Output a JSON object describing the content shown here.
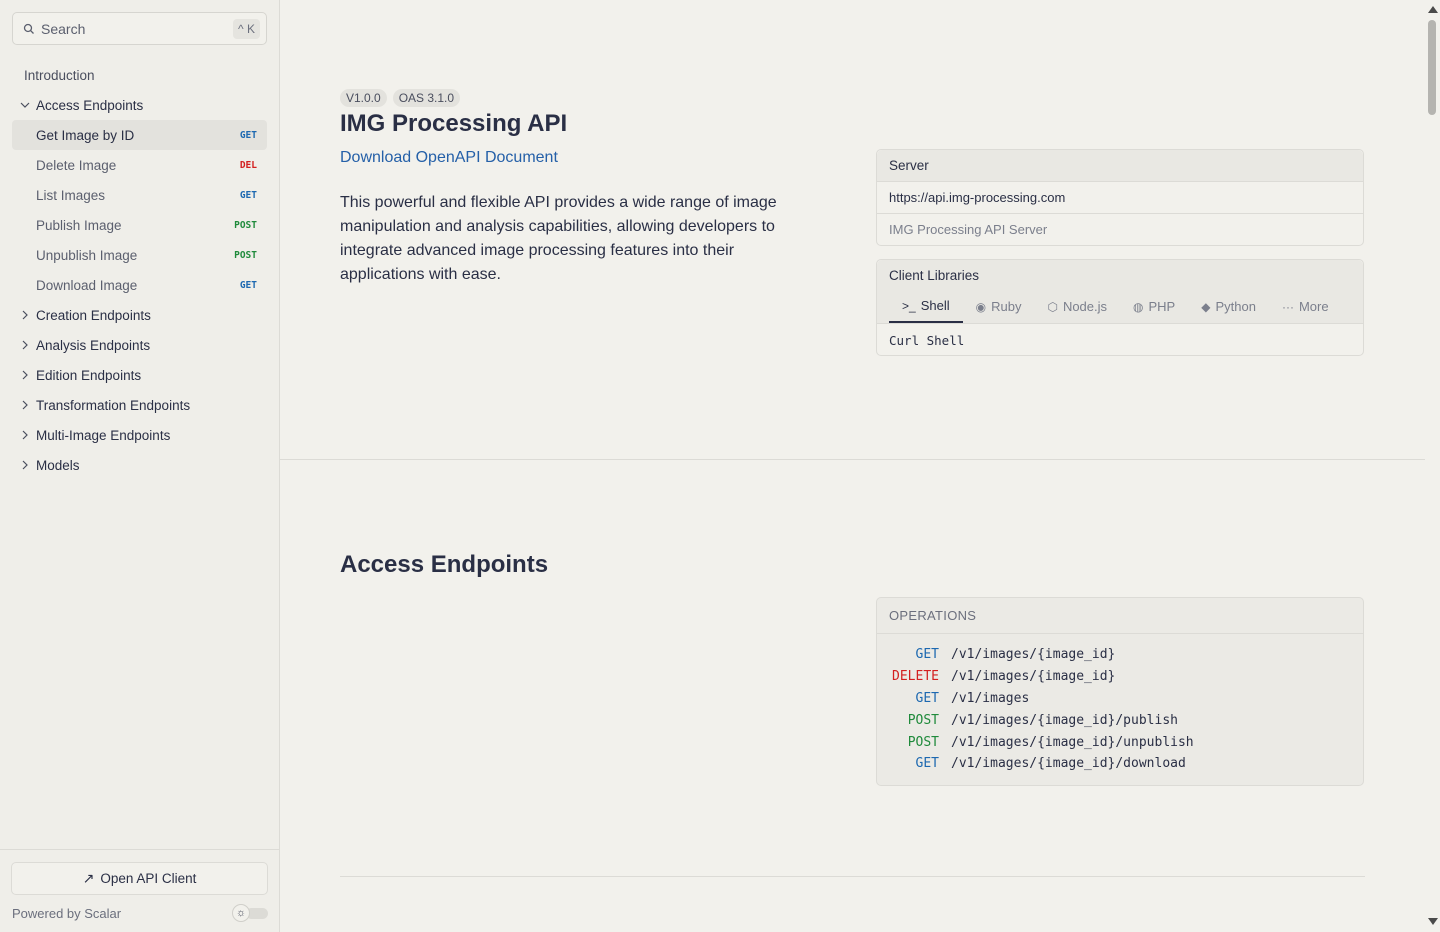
{
  "sidebar": {
    "search": {
      "placeholder": "Search",
      "shortcut": "^ K"
    },
    "introduction": "Introduction",
    "access_group": "Access Endpoints",
    "access_items": [
      {
        "label": "Get Image by ID",
        "method": "GET"
      },
      {
        "label": "Delete Image",
        "method": "DEL"
      },
      {
        "label": "List Images",
        "method": "GET"
      },
      {
        "label": "Publish Image",
        "method": "POST"
      },
      {
        "label": "Unpublish Image",
        "method": "POST"
      },
      {
        "label": "Download Image",
        "method": "GET"
      }
    ],
    "groups": [
      "Creation Endpoints",
      "Analysis Endpoints",
      "Edition Endpoints",
      "Transformation Endpoints",
      "Multi-Image Endpoints",
      "Models"
    ],
    "open_client": "Open API Client",
    "powered_by": "Powered by Scalar"
  },
  "header": {
    "version": "V1.0.0",
    "oas": "OAS 3.1.0",
    "title": "IMG Processing API",
    "download_link": "Download OpenAPI Document",
    "description": "This powerful and flexible API provides a wide range of image manipulation and analysis capabilities, allowing developers to integrate advanced image processing features into their applications with ease."
  },
  "server": {
    "label": "Server",
    "url": "https://api.img-processing.com",
    "description": "IMG Processing API Server"
  },
  "client_libraries": {
    "label": "Client Libraries",
    "tabs": [
      {
        "icon": ">_",
        "label": "Shell"
      },
      {
        "icon": "◉",
        "label": "Ruby"
      },
      {
        "icon": "⬡",
        "label": "Node.js"
      },
      {
        "icon": "◍",
        "label": "PHP"
      },
      {
        "icon": "◆",
        "label": "Python"
      },
      {
        "icon": "···",
        "label": "More"
      }
    ],
    "selected": "Curl Shell"
  },
  "section": {
    "title": "Access Endpoints",
    "operations_label": "OPERATIONS",
    "operations": [
      {
        "method": "GET",
        "path": "/v1/images/{image_id}"
      },
      {
        "method": "DELETE",
        "path": "/v1/images/{image_id}"
      },
      {
        "method": "GET",
        "path": "/v1/images"
      },
      {
        "method": "POST",
        "path": "/v1/images/{image_id}/publish"
      },
      {
        "method": "POST",
        "path": "/v1/images/{image_id}/unpublish"
      },
      {
        "method": "GET",
        "path": "/v1/images/{image_id}/download"
      }
    ]
  },
  "colors": {
    "get": "#1c68b0",
    "delete": "#d31f1f",
    "post": "#1f8a3b",
    "link": "#2560a8"
  }
}
